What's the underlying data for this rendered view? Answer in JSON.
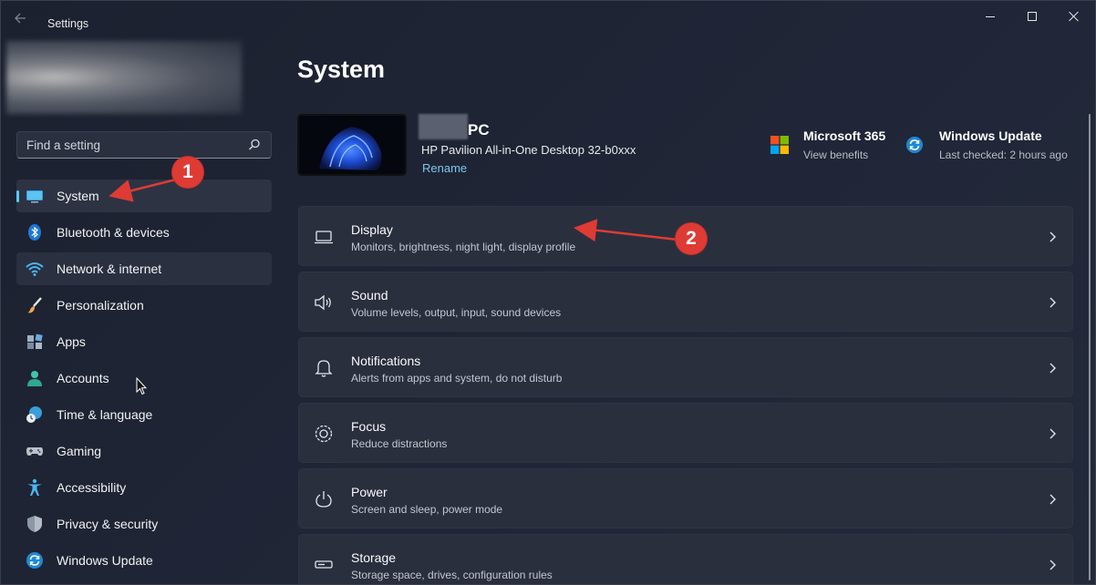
{
  "window": {
    "title": "Settings"
  },
  "search": {
    "placeholder": "Find a setting"
  },
  "sidebar": {
    "items": [
      {
        "label": "System",
        "icon": "monitor-icon",
        "selected": true
      },
      {
        "label": "Bluetooth & devices",
        "icon": "bluetooth-icon"
      },
      {
        "label": "Network & internet",
        "icon": "wifi-icon",
        "hovered": true
      },
      {
        "label": "Personalization",
        "icon": "paintbrush-icon"
      },
      {
        "label": "Apps",
        "icon": "apps-icon"
      },
      {
        "label": "Accounts",
        "icon": "person-icon"
      },
      {
        "label": "Time & language",
        "icon": "globe-clock-icon"
      },
      {
        "label": "Gaming",
        "icon": "gamepad-icon"
      },
      {
        "label": "Accessibility",
        "icon": "accessibility-icon"
      },
      {
        "label": "Privacy & security",
        "icon": "shield-icon"
      },
      {
        "label": "Windows Update",
        "icon": "refresh-icon"
      }
    ]
  },
  "main": {
    "title": "System",
    "device": {
      "name": "PC",
      "model": "HP Pavilion All-in-One Desktop 32-b0xxx",
      "rename_label": "Rename"
    },
    "promos": [
      {
        "title": "Microsoft 365",
        "subtitle": "View benefits",
        "icon": "microsoft-logo-icon"
      },
      {
        "title": "Windows Update",
        "subtitle": "Last checked: 2 hours ago",
        "icon": "windows-update-icon"
      }
    ],
    "cards": [
      {
        "title": "Display",
        "subtitle": "Monitors, brightness, night light, display profile",
        "icon": "display-icon"
      },
      {
        "title": "Sound",
        "subtitle": "Volume levels, output, input, sound devices",
        "icon": "speaker-icon"
      },
      {
        "title": "Notifications",
        "subtitle": "Alerts from apps and system, do not disturb",
        "icon": "bell-icon"
      },
      {
        "title": "Focus",
        "subtitle": "Reduce distractions",
        "icon": "focus-icon"
      },
      {
        "title": "Power",
        "subtitle": "Screen and sleep, power mode",
        "icon": "power-icon"
      },
      {
        "title": "Storage",
        "subtitle": "Storage space, drives, configuration rules",
        "icon": "storage-icon"
      }
    ]
  },
  "annotations": {
    "badge_1": "1",
    "badge_2": "2"
  },
  "colors": {
    "accent": "#5ac8fa",
    "link": "#79c6ef",
    "badge": "#de3b35"
  }
}
